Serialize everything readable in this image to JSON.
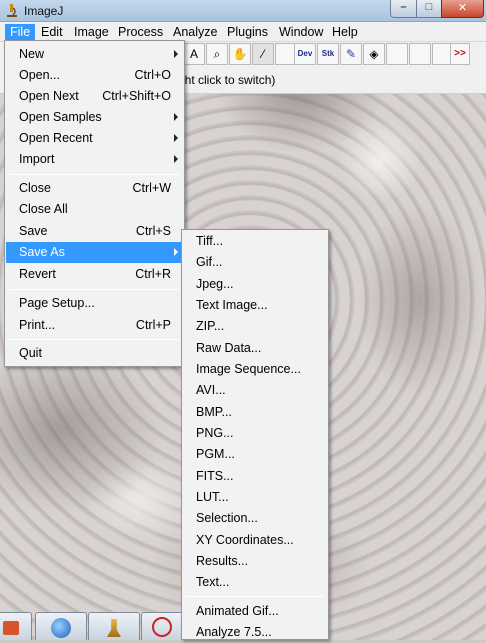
{
  "window": {
    "title": "ImageJ"
  },
  "menubar": [
    "File",
    "Edit",
    "Image",
    "Process",
    "Analyze",
    "Plugins",
    "Window",
    "Help"
  ],
  "toolbar": {
    "tools": [
      {
        "icon": "text-tool-icon",
        "glyph": "A"
      },
      {
        "icon": "magnifier-icon",
        "glyph": "⌕"
      },
      {
        "icon": "hand-icon",
        "glyph": "✋"
      },
      {
        "icon": "color-picker-icon",
        "glyph": "⁄"
      },
      {
        "icon": "blank",
        "glyph": ""
      },
      {
        "icon": "developer-menu-icon",
        "glyph": "Dev"
      },
      {
        "icon": "stack-menu-icon",
        "glyph": "Stk"
      },
      {
        "icon": "brush-icon",
        "glyph": "✎"
      },
      {
        "icon": "flood-fill-icon",
        "glyph": "◈"
      },
      {
        "icon": "blank",
        "glyph": ""
      },
      {
        "icon": "blank",
        "glyph": ""
      },
      {
        "icon": "blank",
        "glyph": ""
      },
      {
        "icon": "blank",
        "glyph": ""
      },
      {
        "icon": "more-tools-icon",
        "glyph": ">>"
      }
    ]
  },
  "status": {
    "text": "ght click to switch)"
  },
  "file_menu": {
    "items": [
      {
        "label": "New",
        "shortcut": "",
        "submenu": true
      },
      {
        "label": "Open...",
        "shortcut": "Ctrl+O",
        "submenu": false
      },
      {
        "label": "Open Next",
        "shortcut": "Ctrl+Shift+O",
        "submenu": false
      },
      {
        "label": "Open Samples",
        "shortcut": "",
        "submenu": true
      },
      {
        "label": "Open Recent",
        "shortcut": "",
        "submenu": true
      },
      {
        "label": "Import",
        "shortcut": "",
        "submenu": true
      },
      {
        "label": "Close",
        "shortcut": "Ctrl+W",
        "submenu": false
      },
      {
        "label": "Close All",
        "shortcut": "",
        "submenu": false
      },
      {
        "label": "Save",
        "shortcut": "Ctrl+S",
        "submenu": false
      },
      {
        "label": "Save As",
        "shortcut": "",
        "submenu": true
      },
      {
        "label": "Revert",
        "shortcut": "Ctrl+R",
        "submenu": false
      },
      {
        "label": "Page Setup...",
        "shortcut": "",
        "submenu": false
      },
      {
        "label": "Print...",
        "shortcut": "Ctrl+P",
        "submenu": false
      },
      {
        "label": "Quit",
        "shortcut": "",
        "submenu": false
      }
    ]
  },
  "save_as_menu": {
    "items": [
      "Tiff...",
      "Gif...",
      "Jpeg...",
      "Text Image...",
      "ZIP...",
      "Raw Data...",
      "Image Sequence...",
      "AVI...",
      "BMP...",
      "PNG...",
      "PGM...",
      "FITS...",
      "LUT...",
      "Selection...",
      "XY Coordinates...",
      "Results...",
      "Text...",
      "Animated Gif...",
      "Analyze 7.5..."
    ]
  },
  "colors": {
    "highlight": "#3399ff",
    "menu_bg": "#f2f2f2"
  }
}
